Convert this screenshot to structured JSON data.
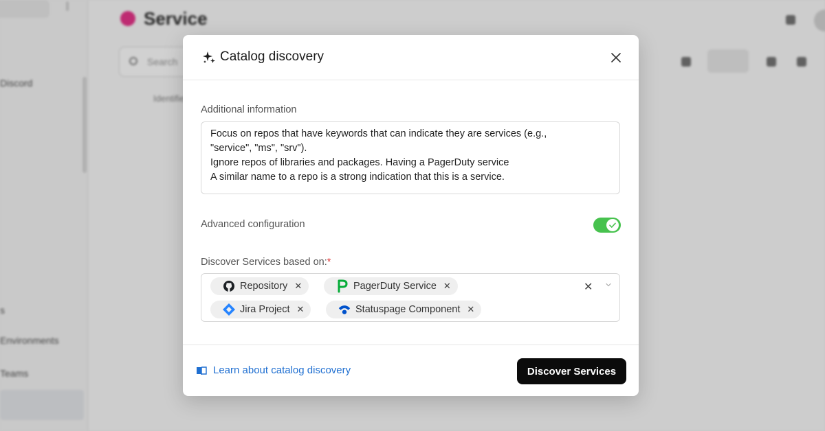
{
  "background": {
    "page_title": "Service",
    "search_placeholder": "Search",
    "column_header": "Identifier",
    "sidebar_items": [
      "Discord",
      "Environments",
      "Teams",
      "s"
    ]
  },
  "modal": {
    "title": "Catalog discovery",
    "additional_info": {
      "label": "Additional information",
      "value": "Focus on repos that have keywords that can indicate they are services (e.g.,\n\"service\", \"ms\", \"srv\").\nIgnore repos of libraries and packages. Having a PagerDuty service\nA similar name to a repo is a strong indication that this is a service."
    },
    "advanced_config": {
      "label": "Advanced configuration",
      "enabled": true
    },
    "discover_based_on": {
      "label": "Discover Services based on:",
      "required_mark": "*",
      "tags": [
        {
          "label": "Repository",
          "icon": "github-icon"
        },
        {
          "label": "PagerDuty Service",
          "icon": "pagerduty-icon"
        },
        {
          "label": "Jira Project",
          "icon": "jira-icon"
        },
        {
          "label": "Statuspage Component",
          "icon": "statuspage-icon"
        }
      ],
      "remove_glyph": "✕",
      "clear_glyph": "✕"
    },
    "footer": {
      "learn_link": "Learn about catalog discovery",
      "submit_label": "Discover Services"
    }
  },
  "colors": {
    "toggle_on": "#47c24e",
    "link": "#1f6fd1",
    "primary_button": "#0b0b0b",
    "required": "#e03b3b",
    "pagerduty": "#06ac38",
    "jira": "#2684ff",
    "statuspage": "#0052cc"
  }
}
